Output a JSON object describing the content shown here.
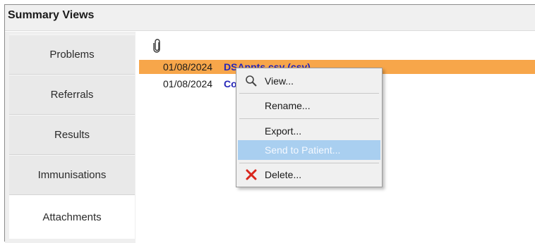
{
  "header": {
    "title": "Summary Views"
  },
  "nav": {
    "items": [
      {
        "label": "Problems"
      },
      {
        "label": "Referrals"
      },
      {
        "label": "Results"
      },
      {
        "label": "Immunisations"
      },
      {
        "label": "Attachments"
      }
    ],
    "selected": "Attachments"
  },
  "attachments": {
    "rows": [
      {
        "date": "01/08/2024",
        "name": "DSAppts.csv (csv)"
      },
      {
        "date": "01/08/2024",
        "name": "Co"
      }
    ]
  },
  "context_menu": {
    "view": "View...",
    "rename": "Rename...",
    "export": "Export...",
    "send": "Send to Patient...",
    "delete": "Delete..."
  },
  "colors": {
    "selected_row": "#f7a64a",
    "file_link": "#2626b8",
    "disabled_highlight": "#a9cff0",
    "delete_icon": "#d9261c"
  }
}
